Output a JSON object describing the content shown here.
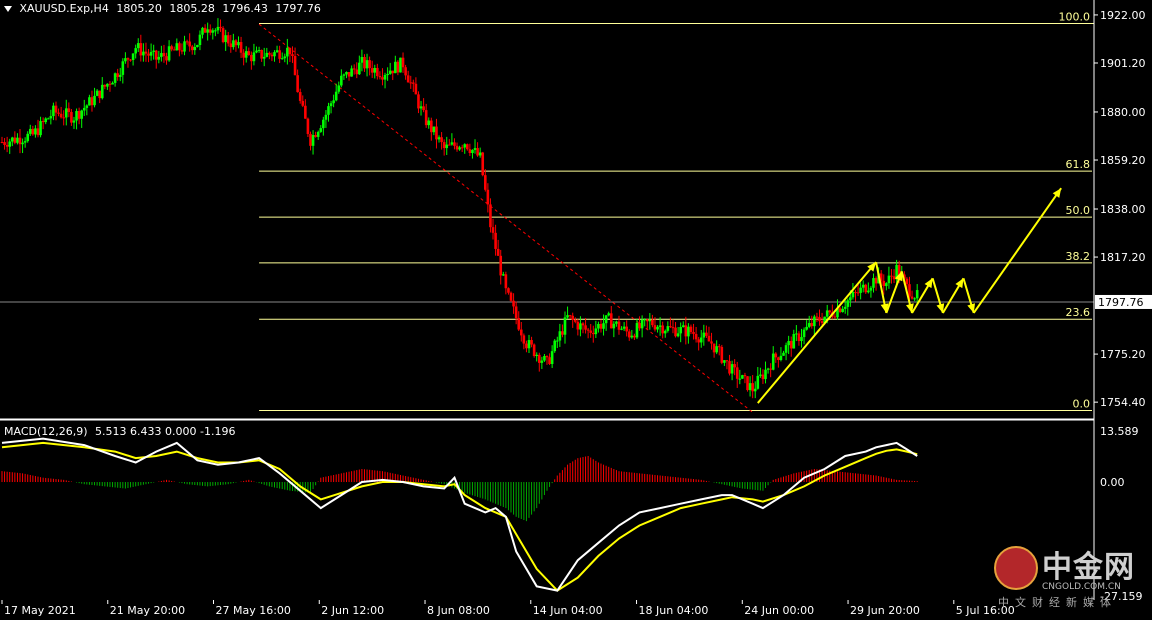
{
  "header": {
    "symbol": "XAUUSD.Exp,H4",
    "open": "1805.20",
    "high": "1805.28",
    "low": "1796.43",
    "close": "1797.76"
  },
  "macd": {
    "title": "MACD(12,26,9)",
    "values": "5.513 6.433 0.000 -1.196"
  },
  "watermark": {
    "name": "中金网",
    "domain": "CNGOLD.COM.CN",
    "subtitle": "中文财经新媒体"
  },
  "colors": {
    "background": "#000000",
    "bull_candle": "#00ff00",
    "bear_candle": "#ff0000",
    "fib_lines": "#ffff99",
    "arrows": "#ffff00",
    "macd_main": "#ffffff",
    "macd_signal": "#ffff00",
    "hist_pos": "#ff0000",
    "hist_neg": "#00aa00",
    "trend_line": "#ff0000"
  },
  "chart_data": [
    {
      "type": "candlestick",
      "symbol": "XAUUSD.Exp",
      "timeframe": "H4",
      "y_ticks": [
        "1922.00",
        "1901.20",
        "1880.00",
        "1859.20",
        "1838.00",
        "1817.20",
        "1775.20",
        "1754.40"
      ],
      "ylim": [
        1751,
        1925
      ],
      "current_price": "1797.76",
      "x_ticks": [
        "17 May 2021",
        "21 May 20:00",
        "27 May 16:00",
        "2 Jun 12:00",
        "8 Jun 08:00",
        "14 Jun 04:00",
        "18 Jun 04:00",
        "24 Jun 00:00",
        "29 Jun 20:00",
        "5 Jul 16:00"
      ],
      "close_path": [
        [
          0,
          1867
        ],
        [
          6,
          1870
        ],
        [
          10,
          1880
        ],
        [
          14,
          1878
        ],
        [
          18,
          1886
        ],
        [
          22,
          1896
        ],
        [
          26,
          1908
        ],
        [
          30,
          1903
        ],
        [
          34,
          1907
        ],
        [
          38,
          1910
        ],
        [
          40,
          1918
        ],
        [
          44,
          1911
        ],
        [
          48,
          1904
        ],
        [
          52,
          1905
        ],
        [
          56,
          1907
        ],
        [
          58,
          1884
        ],
        [
          60,
          1868
        ],
        [
          63,
          1879
        ],
        [
          66,
          1894
        ],
        [
          70,
          1901
        ],
        [
          74,
          1897
        ],
        [
          78,
          1901
        ],
        [
          82,
          1878
        ],
        [
          86,
          1864
        ],
        [
          90,
          1867
        ],
        [
          93,
          1860
        ],
        [
          95,
          1831
        ],
        [
          98,
          1802
        ],
        [
          102,
          1780
        ],
        [
          106,
          1771
        ],
        [
          110,
          1791
        ],
        [
          114,
          1785
        ],
        [
          118,
          1790
        ],
        [
          122,
          1784
        ],
        [
          126,
          1789
        ],
        [
          130,
          1786
        ],
        [
          134,
          1785
        ],
        [
          138,
          1780
        ],
        [
          142,
          1768
        ],
        [
          146,
          1760
        ],
        [
          150,
          1773
        ],
        [
          154,
          1781
        ],
        [
          158,
          1789
        ],
        [
          162,
          1794
        ],
        [
          166,
          1801
        ],
        [
          170,
          1808
        ],
        [
          172,
          1806
        ],
        [
          174,
          1812
        ],
        [
          176,
          1804
        ],
        [
          178,
          1800
        ]
      ],
      "fibonacci": {
        "high": 1918.3,
        "low": 1750.8,
        "levels": [
          {
            "label": "100.0",
            "value": 1918.3
          },
          {
            "label": "61.8",
            "value": 1854.4
          },
          {
            "label": "50.0",
            "value": 1834.5
          },
          {
            "label": "38.2",
            "value": 1814.7
          },
          {
            "label": "23.6",
            "value": 1790.3
          },
          {
            "label": "0.0",
            "value": 1750.8
          }
        ]
      },
      "trend_line": {
        "from": [
          50,
          1918
        ],
        "to": [
          146,
          1750
        ]
      },
      "projection_arrows": [
        [
          [
            147,
            1754
          ],
          [
            170,
            1815
          ]
        ],
        [
          [
            170,
            1815
          ],
          [
            172,
            1793
          ]
        ],
        [
          [
            172,
            1793
          ],
          [
            175,
            1811
          ]
        ],
        [
          [
            175,
            1811
          ],
          [
            177,
            1793
          ]
        ],
        [
          [
            177,
            1793
          ],
          [
            181,
            1808
          ]
        ],
        [
          [
            181,
            1808
          ],
          [
            183,
            1793
          ]
        ],
        [
          [
            183,
            1793
          ],
          [
            187,
            1808
          ]
        ],
        [
          [
            187,
            1808
          ],
          [
            189,
            1793
          ]
        ],
        [
          [
            189,
            1793
          ],
          [
            206,
            1847
          ]
        ]
      ]
    },
    {
      "type": "macd",
      "params": "12,26,9",
      "values": {
        "main": 5.513,
        "signal": 6.433,
        "third": 0.0,
        "fourth": -1.196
      },
      "y_ticks": [
        "13.589",
        "0.00",
        "-27.159"
      ],
      "ylim": [
        -27.159,
        13.589
      ],
      "main_line": [
        [
          0,
          9
        ],
        [
          8,
          10
        ],
        [
          16,
          8.5
        ],
        [
          22,
          6
        ],
        [
          26,
          4.5
        ],
        [
          30,
          7
        ],
        [
          34,
          9
        ],
        [
          38,
          5
        ],
        [
          42,
          4
        ],
        [
          46,
          4.5
        ],
        [
          50,
          5.5
        ],
        [
          54,
          2
        ],
        [
          58,
          -2
        ],
        [
          62,
          -6
        ],
        [
          66,
          -3
        ],
        [
          70,
          0
        ],
        [
          74,
          0.5
        ],
        [
          78,
          0
        ],
        [
          82,
          -1
        ],
        [
          86,
          -1.5
        ],
        [
          88,
          1
        ],
        [
          90,
          -5
        ],
        [
          94,
          -7
        ],
        [
          96,
          -6
        ],
        [
          98,
          -8
        ],
        [
          100,
          -16
        ],
        [
          104,
          -24
        ],
        [
          108,
          -25
        ],
        [
          112,
          -18
        ],
        [
          116,
          -14
        ],
        [
          120,
          -10
        ],
        [
          124,
          -7
        ],
        [
          128,
          -6
        ],
        [
          132,
          -5
        ],
        [
          136,
          -4
        ],
        [
          140,
          -3
        ],
        [
          142,
          -3
        ],
        [
          146,
          -5
        ],
        [
          148,
          -6
        ],
        [
          152,
          -3
        ],
        [
          156,
          1
        ],
        [
          160,
          3
        ],
        [
          164,
          6
        ],
        [
          168,
          7
        ],
        [
          170,
          8
        ],
        [
          172,
          8.5
        ],
        [
          174,
          9
        ],
        [
          176,
          7.5
        ],
        [
          178,
          6
        ]
      ],
      "signal_line": [
        [
          0,
          8
        ],
        [
          8,
          9
        ],
        [
          16,
          8
        ],
        [
          22,
          7
        ],
        [
          26,
          5.5
        ],
        [
          30,
          6
        ],
        [
          34,
          7
        ],
        [
          38,
          5.5
        ],
        [
          42,
          4.5
        ],
        [
          46,
          4.5
        ],
        [
          50,
          5
        ],
        [
          54,
          3
        ],
        [
          58,
          -1
        ],
        [
          62,
          -4
        ],
        [
          66,
          -2.5
        ],
        [
          70,
          -1
        ],
        [
          74,
          0
        ],
        [
          78,
          0
        ],
        [
          82,
          -0.5
        ],
        [
          86,
          -1
        ],
        [
          88,
          -0.5
        ],
        [
          90,
          -3
        ],
        [
          94,
          -6
        ],
        [
          96,
          -7
        ],
        [
          98,
          -8
        ],
        [
          100,
          -12
        ],
        [
          104,
          -20
        ],
        [
          108,
          -25
        ],
        [
          112,
          -22
        ],
        [
          116,
          -17
        ],
        [
          120,
          -13
        ],
        [
          124,
          -10
        ],
        [
          128,
          -8
        ],
        [
          132,
          -6
        ],
        [
          136,
          -5
        ],
        [
          140,
          -4
        ],
        [
          142,
          -3.5
        ],
        [
          146,
          -4
        ],
        [
          148,
          -4.5
        ],
        [
          152,
          -3
        ],
        [
          156,
          -1
        ],
        [
          160,
          1.5
        ],
        [
          164,
          3.5
        ],
        [
          168,
          5.5
        ],
        [
          170,
          6.5
        ],
        [
          172,
          7.2
        ],
        [
          174,
          7.5
        ],
        [
          176,
          7
        ],
        [
          178,
          6.4
        ]
      ],
      "histogram": [
        [
          0,
          2.5
        ],
        [
          4,
          2
        ],
        [
          8,
          1
        ],
        [
          12,
          0.5
        ],
        [
          16,
          -0.5
        ],
        [
          20,
          -1
        ],
        [
          24,
          -1.5
        ],
        [
          28,
          -0.5
        ],
        [
          32,
          0.5
        ],
        [
          36,
          -0.5
        ],
        [
          40,
          -1
        ],
        [
          44,
          -0.5
        ],
        [
          48,
          0.5
        ],
        [
          52,
          -1
        ],
        [
          56,
          -2
        ],
        [
          60,
          -2.5
        ],
        [
          62,
          1
        ],
        [
          66,
          2
        ],
        [
          70,
          3
        ],
        [
          74,
          2.5
        ],
        [
          78,
          1.5
        ],
        [
          82,
          0.5
        ],
        [
          86,
          -0.5
        ],
        [
          88,
          -1.5
        ],
        [
          90,
          -2.5
        ],
        [
          94,
          -4
        ],
        [
          98,
          -6
        ],
        [
          100,
          -8
        ],
        [
          102,
          -9
        ],
        [
          104,
          -6
        ],
        [
          106,
          -2
        ],
        [
          108,
          1.5
        ],
        [
          110,
          4
        ],
        [
          112,
          5.5
        ],
        [
          114,
          6
        ],
        [
          116,
          4.5
        ],
        [
          118,
          3.5
        ],
        [
          120,
          2.5
        ],
        [
          124,
          2
        ],
        [
          128,
          1.5
        ],
        [
          132,
          1
        ],
        [
          136,
          0.5
        ],
        [
          140,
          -0.5
        ],
        [
          144,
          -1.5
        ],
        [
          148,
          -2
        ],
        [
          150,
          0.5
        ],
        [
          154,
          2
        ],
        [
          158,
          3
        ],
        [
          162,
          2.5
        ],
        [
          166,
          2
        ],
        [
          170,
          1.5
        ],
        [
          174,
          0.5
        ],
        [
          178,
          0.2
        ]
      ]
    }
  ]
}
